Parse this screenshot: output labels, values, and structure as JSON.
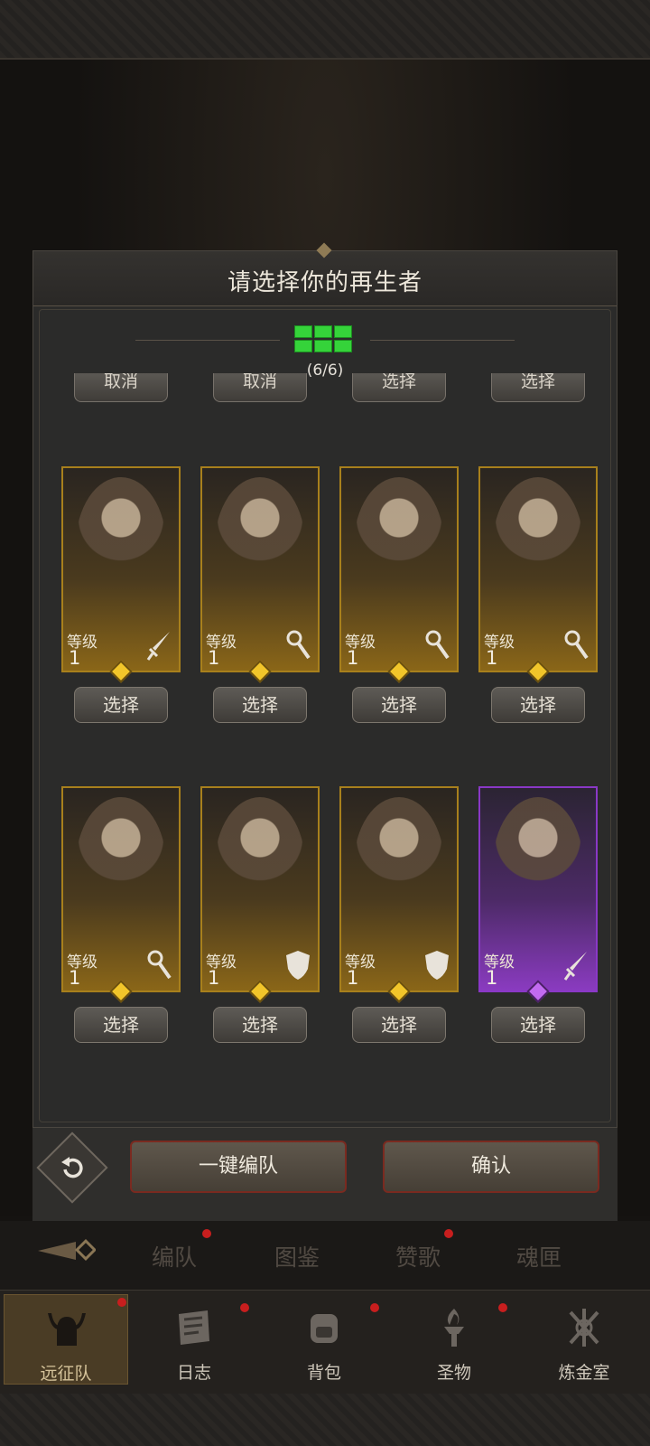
{
  "dialog": {
    "title": "请选择你的再生者",
    "team_count": "(6/6)",
    "cut_buttons": [
      "取消",
      "取消",
      "选择",
      "选择"
    ]
  },
  "rows": [
    [
      {
        "level_label": "等级",
        "level": "1",
        "role": "sword-icon",
        "rarity": "gold"
      },
      {
        "level_label": "等级",
        "level": "1",
        "role": "staff-icon",
        "rarity": "gold"
      },
      {
        "level_label": "等级",
        "level": "1",
        "role": "staff-icon",
        "rarity": "gold"
      },
      {
        "level_label": "等级",
        "level": "1",
        "role": "staff-icon",
        "rarity": "gold"
      }
    ],
    [
      {
        "level_label": "等级",
        "level": "1",
        "role": "staff-icon",
        "rarity": "gold"
      },
      {
        "level_label": "等级",
        "level": "1",
        "role": "shield-icon",
        "rarity": "gold"
      },
      {
        "level_label": "等级",
        "level": "1",
        "role": "shield-icon",
        "rarity": "gold"
      },
      {
        "level_label": "等级",
        "level": "1",
        "role": "sword-icon",
        "rarity": "purple"
      }
    ]
  ],
  "select_label": "选择",
  "actions": {
    "auto_team": "一键编队",
    "confirm": "确认"
  },
  "subtabs": [
    "编队",
    "图鉴",
    "赞歌",
    "魂匣"
  ],
  "nav": [
    "远征队",
    "日志",
    "背包",
    "圣物",
    "炼金室"
  ],
  "colors": {
    "team_slot": "#35d33a",
    "gold_border": "#a8801c",
    "purple_border": "#8a38c7",
    "notify_dot": "#c81e1e"
  }
}
